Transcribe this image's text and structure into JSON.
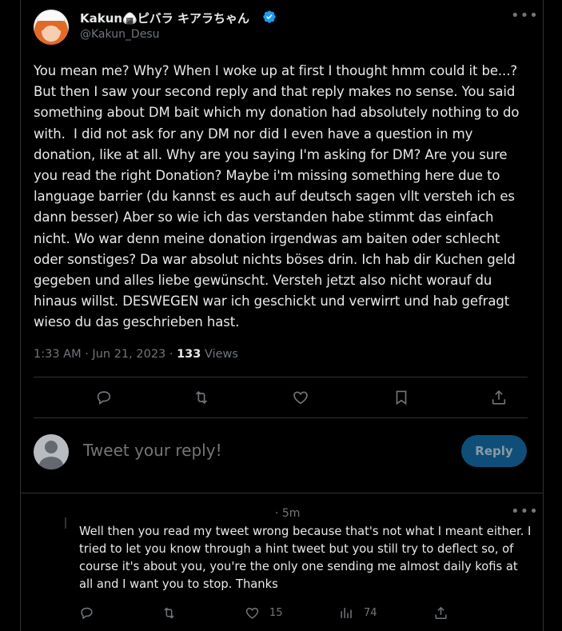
{
  "tweet": {
    "author_name": "Kakun🍙ピバラ キアラちゃん",
    "author_handle": "@Kakun_Desu",
    "text": "You mean me? Why? When I woke up at first I thought hmm could it be...? But then I saw your second reply and that reply makes no sense. You said something about DM bait which my donation had absolutely nothing to do with.  I did not ask for any DM nor did I even have a question in my donation, like at all. Why are you saying I'm asking for DM? Are you sure you read the right Donation? Maybe i'm missing something here due to language barrier (du kannst es auch auf deutsch sagen vllt versteh ich es dann besser) Aber so wie ich das verstanden habe stimmt das einfach nicht. Wo war denn meine donation irgendwas am baiten oder schlecht oder sonstiges? Da war absolut nichts böses drin. Ich hab dir Kuchen geld gegeben und alles liebe gewünscht. Versteh jetzt also nicht worauf du hinaus willst. DESWEGEN war ich geschickt und verwirrt und hab gefragt wieso du das geschrieben hast.",
    "timestamp": "1:33 AM · Jun 21, 2023 · ",
    "views_count": "133",
    "views_label": " Views",
    "actions": [
      "reply-icon",
      "retweet-icon",
      "like-icon",
      "bookmark-icon",
      "share-icon"
    ]
  },
  "composer": {
    "placeholder": "Tweet your reply!",
    "button_label": "Reply"
  },
  "reply": {
    "time": "· 5m",
    "text": "Well then you read my tweet wrong because that's not what I meant either. I tried to let you know through a hint tweet but you still try to deflect so, of course it's about you, you're the only one sending me almost daily kofis at all and I want you to stop. Thanks",
    "like_count": "15",
    "views_count": "74"
  },
  "colors": {
    "background": "#000000",
    "text": "#e7e9ea",
    "muted": "#71767b",
    "border": "#2f3336",
    "accent": "#1d9bf0",
    "reply_button_bg": "#0f4e78"
  }
}
